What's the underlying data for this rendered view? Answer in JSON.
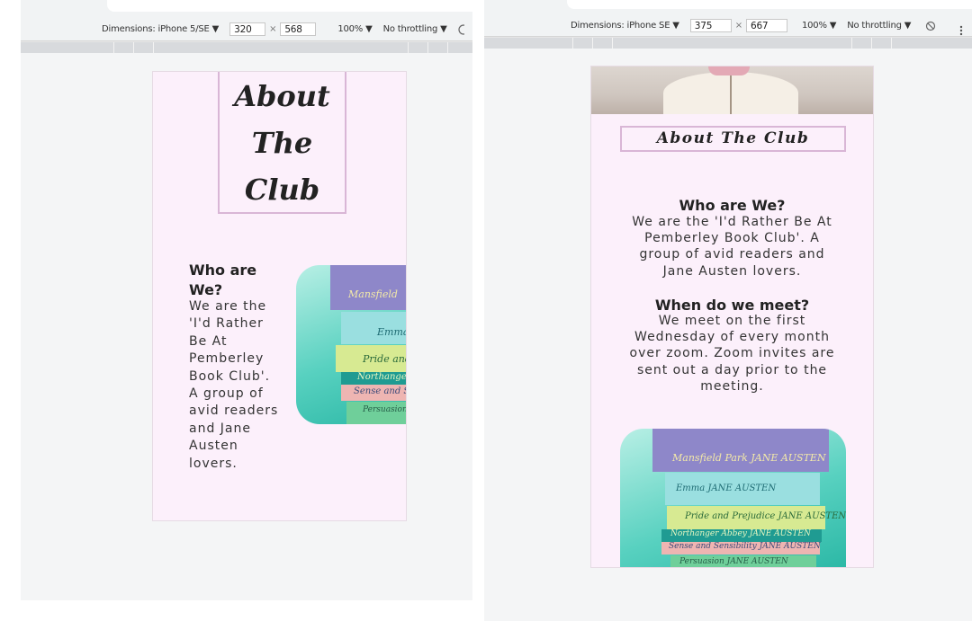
{
  "left_panel": {
    "devtools": {
      "device_label": "Dimensions: iPhone 5/SE ▼",
      "width": "320",
      "times": "×",
      "height": "568",
      "zoom": "100% ▼",
      "throttle": "No throttling ▼"
    },
    "page": {
      "title_lines": [
        "About",
        "The",
        "Club"
      ],
      "heading": "Who are We?",
      "body": "We are the 'I'd Rather Be At Pemberley Book Club'. A group of avid readers and Jane Austen lovers.",
      "book_titles": [
        "Mansfield",
        "Emma",
        "Pride and",
        "Northanger",
        "Sense and Se",
        "Persuasion"
      ]
    }
  },
  "right_panel": {
    "devtools": {
      "device_label": "Dimensions: iPhone SE ▼",
      "width": "375",
      "times": "×",
      "height": "667",
      "zoom": "100% ▼",
      "throttle": "No throttling ▼",
      "rotate_icon": "rotate-icon",
      "more_icon": "more-vertical-icon"
    },
    "page": {
      "title": "About The Club",
      "heading_1": "Who are We?",
      "body_1": "We are the 'I'd Rather Be At Pemberley Book Club'. A group of avid readers and Jane Austen lovers.",
      "heading_2": "When do we meet?",
      "body_2": "We meet on the first Wednesday of every month over zoom. Zoom invites are sent out a day prior to the meeting.",
      "book_titles": [
        "Mansfield Park JANE AUSTEN",
        "Emma JANE AUSTEN",
        "Pride and Prejudice JANE AUSTEN",
        "Northanger Abbey JANE AUSTEN",
        "Sense and Sensibility JANE AUSTEN",
        "Persuasion JANE AUSTEN"
      ]
    }
  },
  "colors": {
    "page_bg": "#fcf0fb",
    "title_border": "#d9b6d6",
    "devtools_bg": "#f1f3f4",
    "ruler": "#d8dadd"
  }
}
